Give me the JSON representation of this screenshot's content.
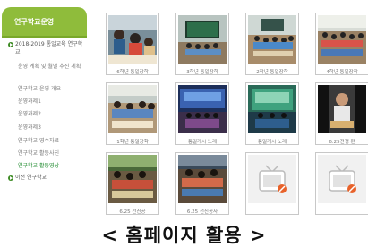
{
  "sidebar": {
    "title": "연구학교운영",
    "items": [
      {
        "label": "2018-2019 통일교육 연구학교",
        "top": true
      },
      {
        "label": "운영 계획 및 월별 추진 계획"
      },
      {
        "label": "연구학교 운영 개요"
      },
      {
        "label": "운영과제1"
      },
      {
        "label": "운영과제2"
      },
      {
        "label": "운영과제3"
      },
      {
        "label": "연구학교 영수자료"
      },
      {
        "label": "연구학교 활동사진"
      },
      {
        "label": "연구학교 활동영상",
        "active": true
      },
      {
        "label": "이전 연구학교",
        "top": true
      }
    ]
  },
  "gallery": {
    "tiles": [
      {
        "caption": "6학년 통일장학"
      },
      {
        "caption": "3학년 통일장학"
      },
      {
        "caption": "2학년 통일장학"
      },
      {
        "caption": "4학년 통일장학"
      },
      {
        "caption": "1학년 통일장학"
      },
      {
        "caption": "통일개시 노래"
      },
      {
        "caption": "통일개시 노래"
      },
      {
        "caption": "6.25전쟁 편"
      },
      {
        "caption": "6.25 전진공"
      },
      {
        "caption": "6.25 전진공사"
      },
      {
        "caption": ""
      },
      {
        "caption": ""
      }
    ]
  },
  "footer_caption": "< 홈페이지 활용 >",
  "colors": {
    "sidebar_header": "#8fbc3b",
    "active_menu": "#1f8a2e",
    "placeholder_badge": "#e8622a"
  }
}
